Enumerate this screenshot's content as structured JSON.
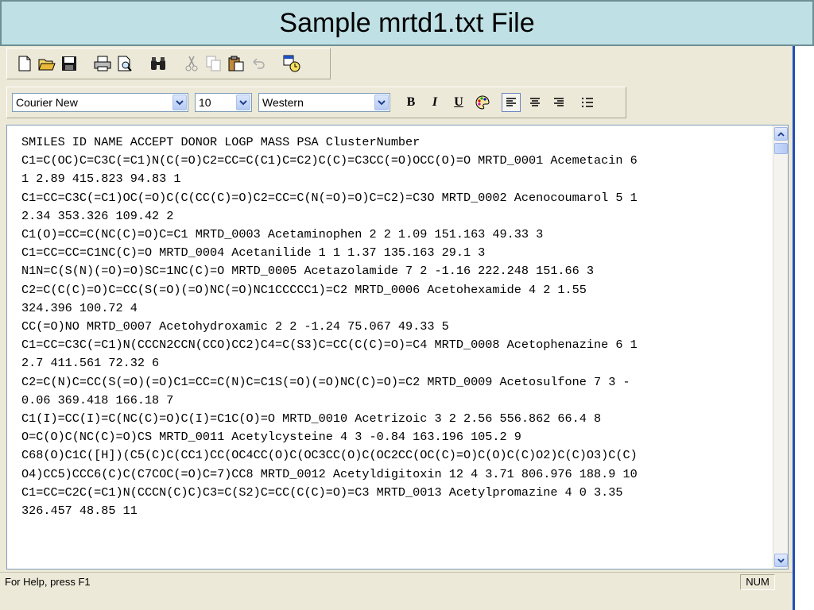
{
  "slide": {
    "title": "Sample mrtd1.txt File"
  },
  "toolbar": {
    "buttons": [
      "new-icon",
      "open-icon",
      "save-icon",
      "print-icon",
      "print-preview-icon",
      "find-icon",
      "cut-icon",
      "copy-icon",
      "paste-icon",
      "undo-icon",
      "insert-datetime-icon"
    ]
  },
  "format_bar": {
    "font": "Courier New",
    "size": "10",
    "script": "Western",
    "bold": "B",
    "italic": "I",
    "underline": "U"
  },
  "document": {
    "lines": [
      "SMILES ID NAME ACCEPT DONOR LOGP MASS PSA ClusterNumber",
      "C1=C(OC)C=C3C(=C1)N(C(=O)C2=CC=C(C1)C=C2)C(C)=C3CC(=O)OCC(O)=O MRTD_0001 Acemetacin 6",
      "1 2.89 415.823 94.83 1",
      "C1=CC=C3C(=C1)OC(=O)C(C(CC(C)=O)C2=CC=C(N(=O)=O)C=C2)=C3O MRTD_0002 Acenocoumarol 5 1",
      "2.34 353.326 109.42 2",
      "C1(O)=CC=C(NC(C)=O)C=C1 MRTD_0003 Acetaminophen 2 2 1.09 151.163 49.33 3",
      "C1=CC=CC=C1NC(C)=O MRTD_0004 Acetanilide 1 1 1.37 135.163 29.1 3",
      "N1N=C(S(N)(=O)=O)SC=1NC(C)=O MRTD_0005 Acetazolamide 7 2 -1.16 222.248 151.66 3",
      "C2=C(C(C)=O)C=CC(S(=O)(=O)NC(=O)NC1CCCCC1)=C2 MRTD_0006 Acetohexamide 4 2 1.55",
      "324.396 100.72 4",
      "CC(=O)NO MRTD_0007 Acetohydroxamic 2 2 -1.24 75.067 49.33 5",
      "C1=CC=C3C(=C1)N(CCCN2CCN(CCO)CC2)C4=C(S3)C=CC(C(C)=O)=C4 MRTD_0008 Acetophenazine 6 1",
      "2.7 411.561 72.32 6",
      "C2=C(N)C=CC(S(=O)(=O)C1=CC=C(N)C=C1S(=O)(=O)NC(C)=O)=C2 MRTD_0009 Acetosulfone 7 3 -",
      "0.06 369.418 166.18 7",
      "C1(I)=CC(I)=C(NC(C)=O)C(I)=C1C(O)=O MRTD_0010 Acetrizoic 3 2 2.56 556.862 66.4 8",
      "O=C(O)C(NC(C)=O)CS MRTD_0011 Acetylcysteine 4 3 -0.84 163.196 105.2 9",
      "C68(O)C1C([H])(C5(C)C(CC1)CC(OC4CC(O)C(OC3CC(O)C(OC2CC(OC(C)=O)C(O)C(C)O2)C(C)O3)C(C)",
      "O4)CC5)CCC6(C)C(C7COC(=O)C=7)CC8 MRTD_0012 Acetyldigitoxin 12 4 3.71 806.976 188.9 10",
      "C1=CC=C2C(=C1)N(CCCN(C)C)C3=C(S2)C=CC(C(C)=O)=C3 MRTD_0013 Acetylpromazine 4 0 3.35",
      "326.457 48.85 11"
    ]
  },
  "status": {
    "help": "For Help, press F1",
    "num": "NUM"
  }
}
